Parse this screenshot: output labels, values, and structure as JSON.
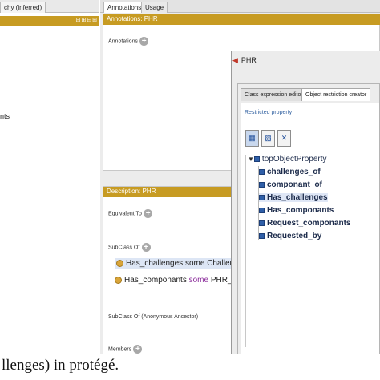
{
  "left_panel": {
    "tab_label": "chy (inferred)",
    "bar_icons": "⊟⊞⊟⊞",
    "tree_fragment": "nts"
  },
  "right_panel": {
    "tabs": [
      {
        "label": "Annotations"
      },
      {
        "label": "Usage"
      }
    ],
    "annotations": {
      "bar_title": "Annotations: PHR",
      "row_label": "Annotations"
    },
    "description": {
      "bar_title": "Description: PHR",
      "equivalent_label": "Equivalent To",
      "subclass_label": "SubClass Of",
      "axioms": [
        {
          "prop": "Has_challenges",
          "keyword": "some",
          "filler": "Challenges"
        },
        {
          "prop": "Has_componants",
          "keyword": "some",
          "filler": "PHR_compon"
        }
      ],
      "anon_label": "SubClass Of (Anonymous Ancestor)",
      "members_label": "Members"
    }
  },
  "dialog": {
    "title": "PHR",
    "tabs": [
      {
        "label": "Class expression editor"
      },
      {
        "label": "Object restriction creator"
      }
    ],
    "restricted_title": "Restricted property",
    "tree": {
      "root": "topObjectProperty",
      "children": [
        "challenges_of",
        "componant_of",
        "Has_challenges",
        "Has_componants",
        "Request_componants",
        "Requested_by"
      ],
      "selected": "Has_challenges"
    }
  },
  "caption": {
    "text": "llenges) in protégé."
  },
  "colors": {
    "gold_bar": "#c79b22",
    "tree_node": "#2f5fa8",
    "axiom_keyword": "#8a2a9a",
    "caption_text": "#111111"
  }
}
